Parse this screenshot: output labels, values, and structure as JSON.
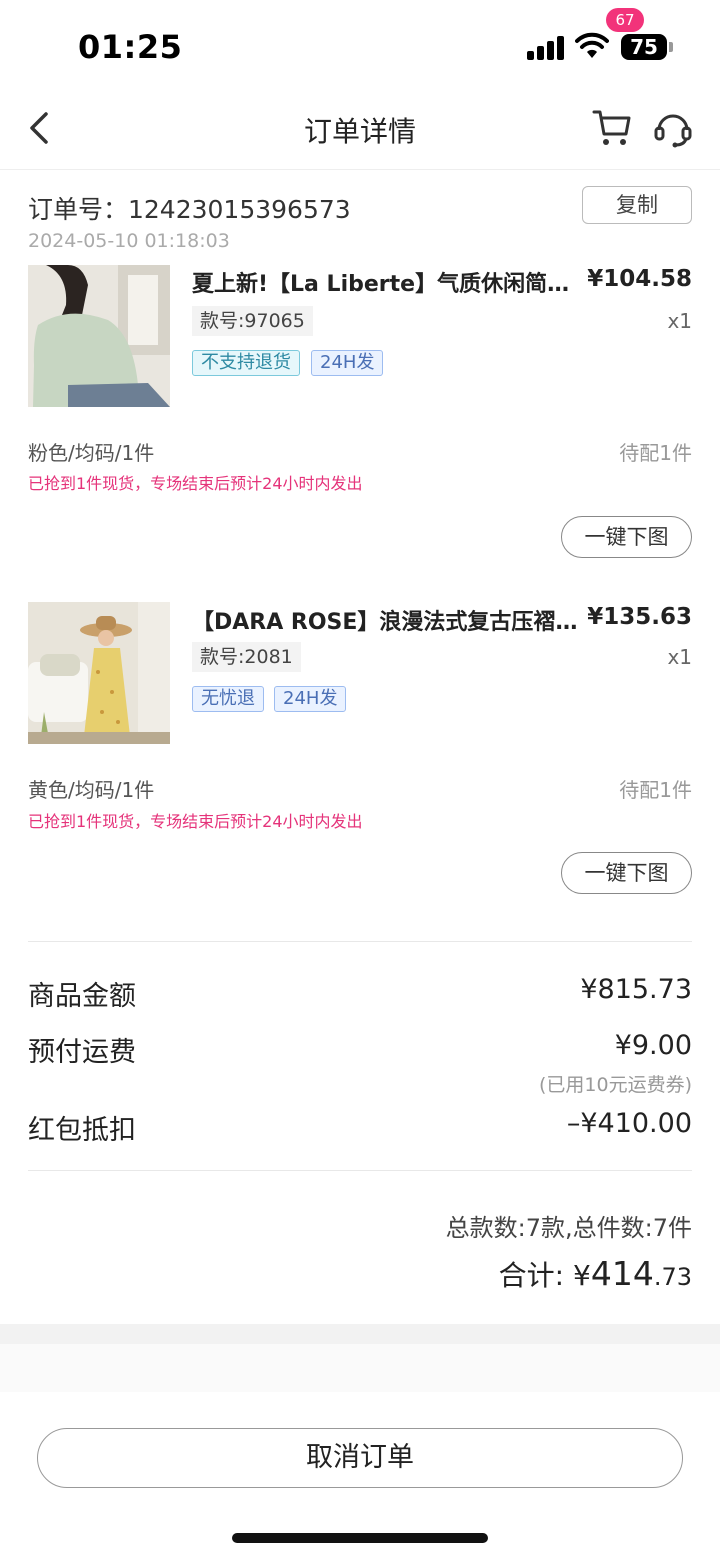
{
  "status_bar": {
    "time": "01:25",
    "battery": "75"
  },
  "nav": {
    "title": "订单详情",
    "cart_badge": "67"
  },
  "order": {
    "number_label": "订单号：12423015396573",
    "time": "2024-05-10 01:18:03",
    "copy_label": "复制"
  },
  "items": [
    {
      "title": "夏上新!【La Liberte】气质休闲简约…",
      "price": "¥104.58",
      "code": "款号:97065",
      "qty": "x1",
      "tags": [
        "不支持退货",
        "24H发"
      ],
      "spec": "粉色/均码/1件",
      "pending": "待配1件",
      "note": "已抢到1件现货，专场结束后预计24小时内发出",
      "download_label": "一键下图"
    },
    {
      "title": "【DARA ROSE】浪漫法式复古压褶连衣裙",
      "price": "¥135.63",
      "code": "款号:2081",
      "qty": "x1",
      "tags": [
        "无忧退",
        "24H发"
      ],
      "spec": "黄色/均码/1件",
      "pending": "待配1件",
      "note": "已抢到1件现货，专场结束后预计24小时内发出",
      "download_label": "一键下图"
    }
  ],
  "summary": {
    "goods_label": "商品金额",
    "goods_value": "¥815.73",
    "freight_label": "预付运费",
    "freight_value": "¥9.00",
    "freight_note": "(已用10元运费券)",
    "redpacket_label": "红包抵扣",
    "redpacket_value": "–¥410.00",
    "count_line": "总款数:7款,总件数:7件",
    "total_label": "合计: ",
    "total_currency": "¥",
    "total_int": "414",
    "total_dec": ".73"
  },
  "bottom": {
    "cancel_label": "取消订单"
  },
  "colors": {
    "accent": "#f2337a",
    "tag_blue": "#4a6fb5",
    "tag_cyan": "#2e8aa3"
  }
}
